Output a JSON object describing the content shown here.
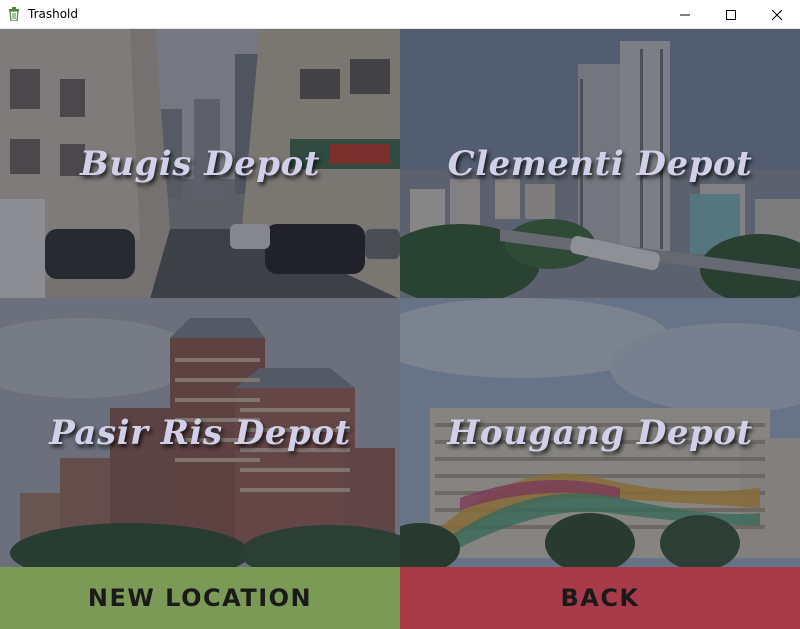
{
  "window": {
    "title": "Trashold",
    "icon": "trash-bin-icon",
    "controls": [
      "minimize-icon",
      "maximize-icon",
      "close-icon"
    ]
  },
  "depots": [
    {
      "label": "Bugis Depot"
    },
    {
      "label": "Clementi Depot"
    },
    {
      "label": "Pasir Ris Depot"
    },
    {
      "label": "Hougang Depot"
    }
  ],
  "buttons": {
    "new_location": "NEW LOCATION",
    "back": "BACK"
  },
  "colors": {
    "new_location_bg": "#7a9a55",
    "back_bg": "#a83a4a",
    "label_text": "#d2d0e8",
    "app_icon": "#4a8a3a"
  }
}
